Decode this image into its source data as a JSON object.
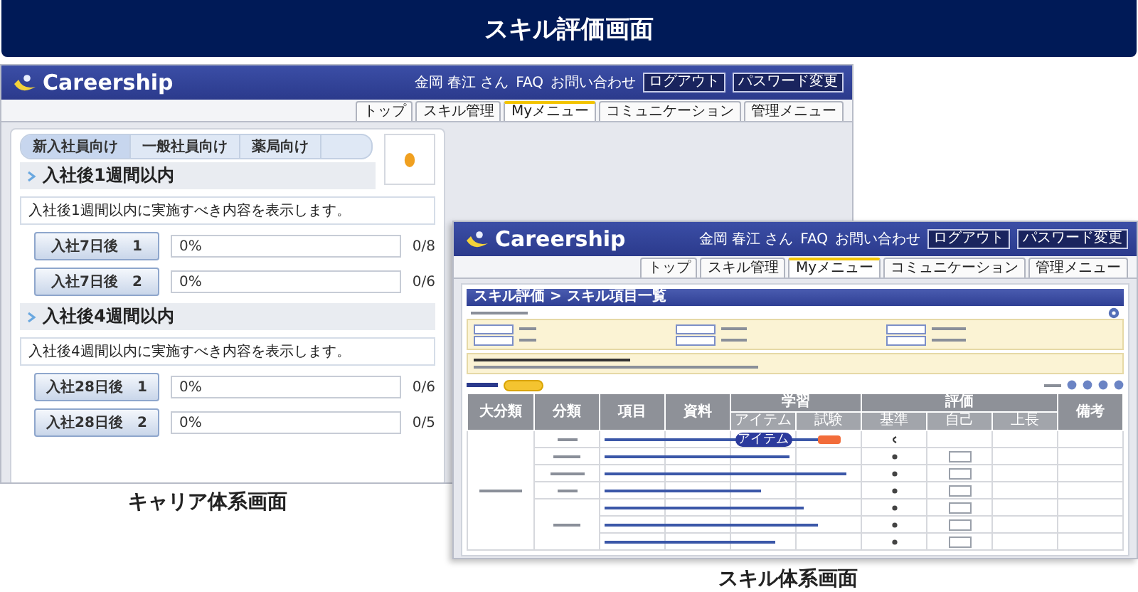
{
  "banner": {
    "title": "スキル評価画面"
  },
  "career_window": {
    "logo": "Careership",
    "user_links": [
      {
        "kind": "text",
        "label": "金岡 春江 さん"
      },
      {
        "kind": "link",
        "label": "FAQ"
      },
      {
        "kind": "link",
        "label": "お問い合わせ"
      },
      {
        "kind": "button",
        "label": "ログアウト"
      },
      {
        "kind": "button",
        "label": "パスワード変更"
      }
    ],
    "nav_tabs": [
      {
        "label": "トップ",
        "selected": false
      },
      {
        "label": "スキル管理",
        "selected": false
      },
      {
        "label": "Myメニュー",
        "selected": true
      },
      {
        "label": "コミュニケーション",
        "selected": false
      },
      {
        "label": "管理メニュー",
        "selected": false
      }
    ],
    "category_tabs": [
      {
        "label": "新入社員向け",
        "selected": true
      },
      {
        "label": "一般社員向け",
        "selected": false
      },
      {
        "label": "薬局向け",
        "selected": false
      }
    ],
    "sections": [
      {
        "title": "入社後1週間以内",
        "description": "入社後1週間以内に実施すべき内容を表示します。",
        "items": [
          {
            "label": "入社7日後　1",
            "level": 0,
            "percent": "0%",
            "count": "0/8"
          },
          {
            "label": "入社7日後　2",
            "level": 0,
            "percent": "0%",
            "count": "0/6"
          }
        ]
      },
      {
        "title": "入社後4週間以内",
        "description": "入社後4週間以内に実施すべき内容を表示します。",
        "items": [
          {
            "label": "入社28日後　1",
            "level": 0,
            "percent": "0%",
            "count": "0/6"
          },
          {
            "label": "入社28日後　2",
            "level": 0,
            "percent": "0%",
            "count": "0/5"
          }
        ]
      }
    ],
    "caption": "キャリア体系画面"
  },
  "skill_window": {
    "logo": "Careership",
    "user_links": [
      {
        "kind": "text",
        "label": "金岡 春江 さん"
      },
      {
        "kind": "link",
        "label": "FAQ"
      },
      {
        "kind": "link",
        "label": "お問い合わせ"
      },
      {
        "kind": "button",
        "label": "ログアウト"
      },
      {
        "kind": "button",
        "label": "パスワード変更"
      }
    ],
    "nav_tabs": [
      {
        "label": "トップ",
        "selected": false
      },
      {
        "label": "スキル管理",
        "selected": false
      },
      {
        "label": "Myメニュー",
        "selected": true
      },
      {
        "label": "コミュニケーション",
        "selected": false
      },
      {
        "label": "管理メニュー",
        "selected": false
      }
    ],
    "breadcrumb": "スキル評価 > スキル項目一覧",
    "table": {
      "columns": [
        {
          "label": "大分類"
        },
        {
          "label": "分類"
        },
        {
          "label": "項目"
        },
        {
          "label": "資料"
        },
        {
          "label": "学習",
          "children": [
            "アイテム",
            "試験"
          ]
        },
        {
          "label": "評価",
          "children": [
            "基準",
            "自己",
            "上長"
          ]
        },
        {
          "label": "備考"
        }
      ],
      "rows": [
        {
          "kind": "badges",
          "item_badge": "アイテム"
        },
        {
          "kind": "select"
        },
        {
          "kind": "select"
        },
        {
          "kind": "select"
        },
        {
          "kind": "select"
        },
        {
          "kind": "select"
        },
        {
          "kind": "select"
        }
      ]
    },
    "caption": "スキル体系画面"
  }
}
